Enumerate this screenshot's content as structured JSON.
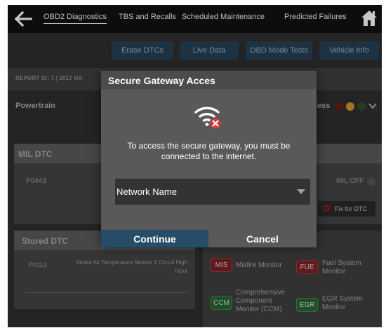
{
  "nav": {
    "tabs": [
      {
        "label": "OBD2 Diagnostics",
        "active": true
      },
      {
        "label": "TBS and Recalls"
      },
      {
        "label": "Scheduled Maintenance"
      },
      {
        "label": "Predicted Failures"
      }
    ]
  },
  "actions": [
    "Erase DTCs",
    "Live Data",
    "OBD Mode Tests",
    "Vehicle Info"
  ],
  "report": {
    "text": "REPORT ID: 7  |  2017 RA"
  },
  "powertrain": {
    "label": "Powertrain",
    "status_suffix": "ess"
  },
  "mil": {
    "title": "MIL DTC",
    "code": "P0443",
    "status": "MIL OFF",
    "fix_label": "Fix for DTC"
  },
  "stored": {
    "title": "Stored DTC",
    "code": "P0113",
    "description": "Intake Air Temperature Sensor 1 Circuit High Input"
  },
  "monitors": [
    {
      "badge": "MIS",
      "label": "Misfire Monitor",
      "color": "red"
    },
    {
      "badge": "FUE",
      "label": "Fuel System Monitor",
      "color": "red"
    },
    {
      "badge": "CCM",
      "label": "Comprehensive Component Monitor (CCM)",
      "color": "green"
    },
    {
      "badge": "EGR",
      "label": "EGR System Monitor",
      "color": "green"
    }
  ],
  "dialog": {
    "title": "Secure Gateway Acces",
    "message": "To access the secure gateway, you must be connected to the internet.",
    "network_label": "Network Name",
    "continue_label": "Continue",
    "cancel_label": "Cancel"
  },
  "colors": {
    "accent_blue": "#254d68",
    "status_red": "#8b1f1f",
    "status_yellow": "#d2a72a",
    "status_green": "#2e6b2e",
    "wifi_error_red": "#e0343a"
  }
}
